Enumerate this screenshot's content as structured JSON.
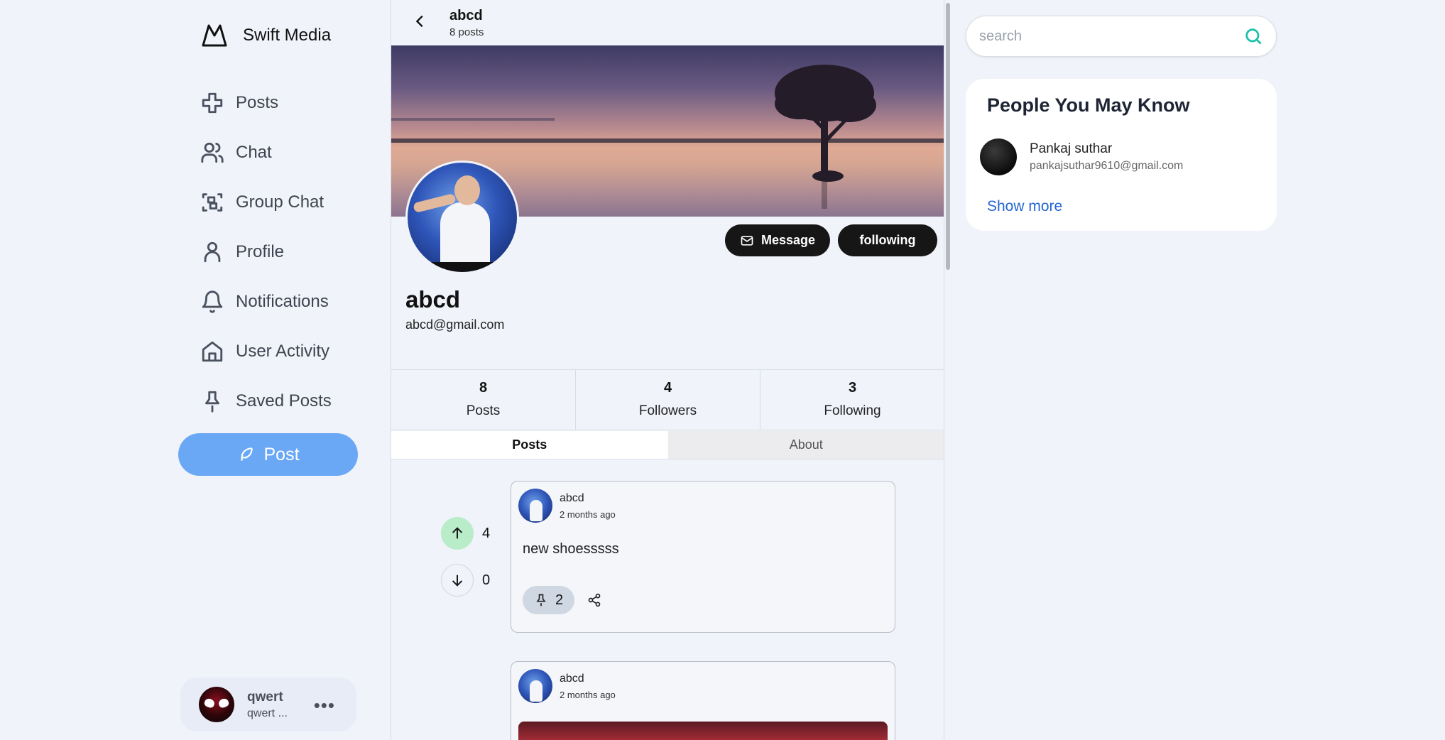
{
  "brand": {
    "name": "Swift Media",
    "icon": "m-logo-icon"
  },
  "nav": {
    "items": [
      {
        "label": "Posts",
        "icon": "plus-cross-icon"
      },
      {
        "label": "Chat",
        "icon": "users-icon"
      },
      {
        "label": "Group Chat",
        "icon": "scan-group-icon"
      },
      {
        "label": "Profile",
        "icon": "user-icon"
      },
      {
        "label": "Notifications",
        "icon": "bell-icon"
      },
      {
        "label": "User Activity",
        "icon": "home-icon"
      },
      {
        "label": "Saved Posts",
        "icon": "pin-icon"
      }
    ],
    "post_button": "Post"
  },
  "current_user": {
    "name": "qwert",
    "handle": "qwert ...",
    "more": "•••"
  },
  "profile_header": {
    "title": "abcd",
    "subtitle": "8 posts"
  },
  "profile": {
    "name": "abcd",
    "email": "abcd@gmail.com",
    "message_button": "Message",
    "follow_button": "following"
  },
  "stats": [
    {
      "value": "8",
      "label": "Posts"
    },
    {
      "value": "4",
      "label": "Followers"
    },
    {
      "value": "3",
      "label": "Following"
    }
  ],
  "tabs": [
    {
      "label": "Posts",
      "active": true
    },
    {
      "label": "About",
      "active": false
    }
  ],
  "posts": [
    {
      "author": "abcd",
      "time": "2 months ago",
      "text": "new shoesssss",
      "upvotes": "4",
      "downvotes": "0",
      "pins": "2"
    },
    {
      "author": "abcd",
      "time": "2 months ago"
    }
  ],
  "search": {
    "placeholder": "search"
  },
  "suggestions": {
    "title": "People You May Know",
    "people": [
      {
        "name": "Pankaj suthar",
        "email": "pankajsuthar9610@gmail.com"
      }
    ],
    "show_more": "Show more"
  },
  "colors": {
    "accent_blue": "#6aa8f6",
    "upvote_green": "#b9ecc9",
    "search_icon": "#1fc0aa",
    "link_blue": "#2366d4"
  }
}
